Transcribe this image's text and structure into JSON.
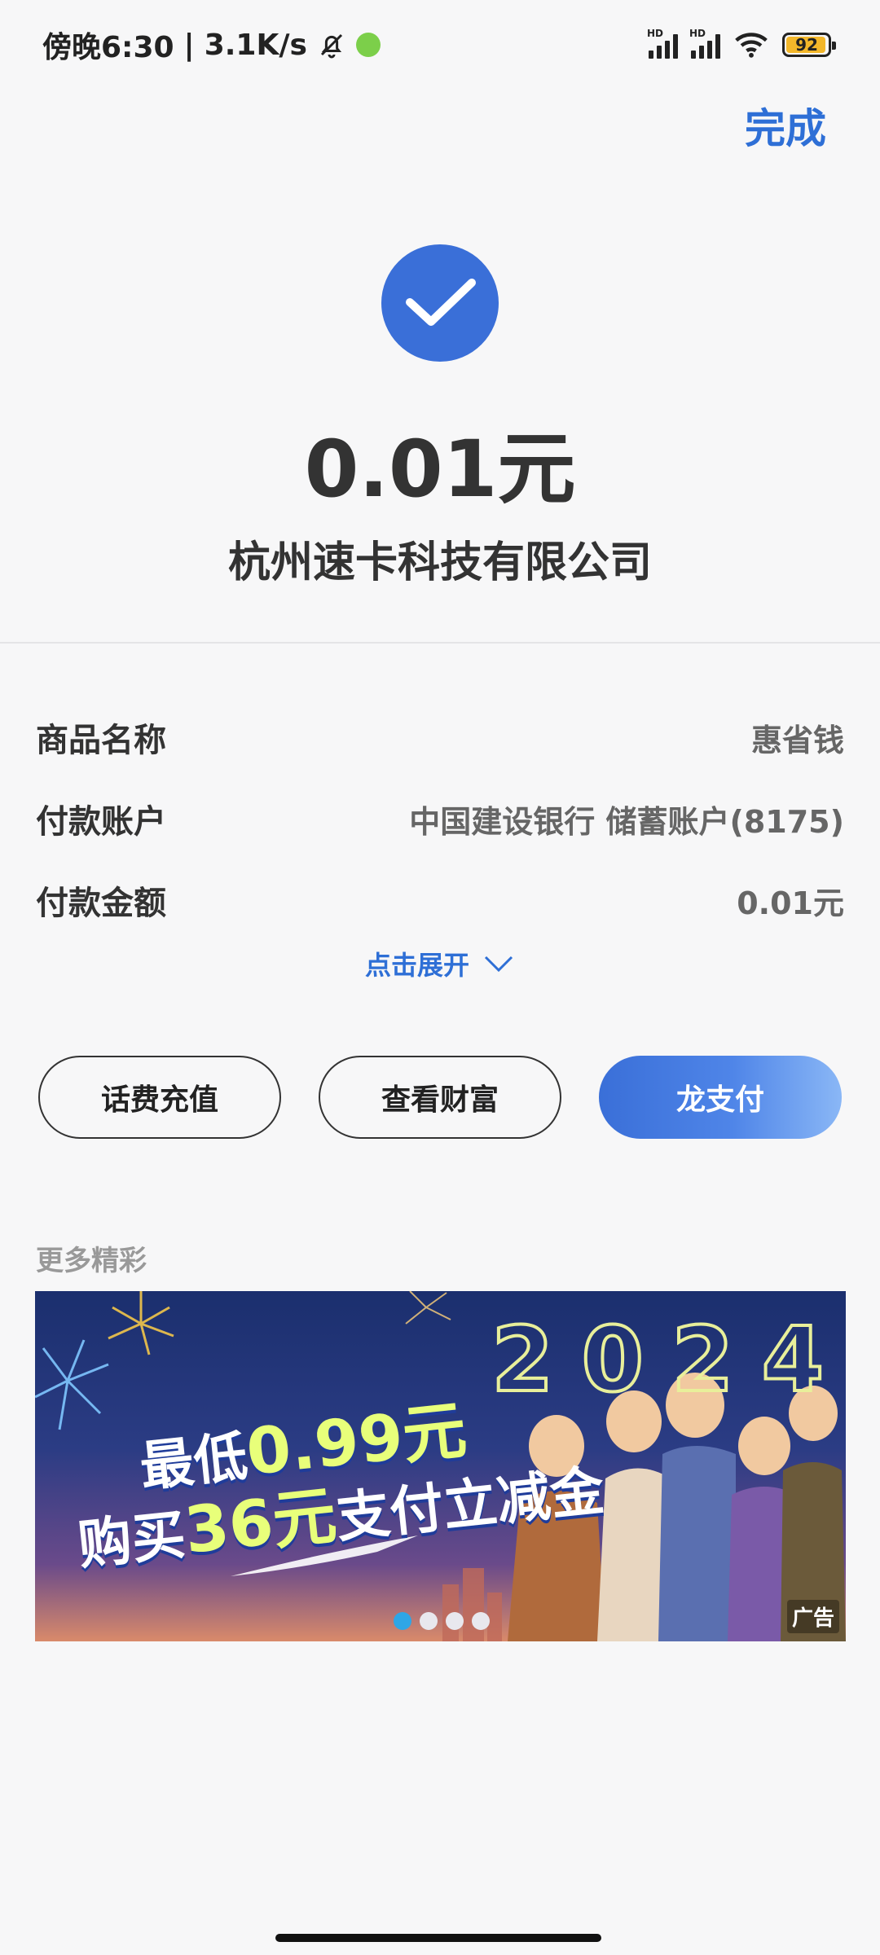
{
  "status_bar": {
    "time": "傍晚6:30",
    "speed": "3.1K/s",
    "separator": "|",
    "hd1": "HD",
    "hd2": "HD",
    "battery": "92"
  },
  "header": {
    "done_label": "完成"
  },
  "result": {
    "amount": "0.01元",
    "merchant": "杭州速卡科技有限公司"
  },
  "details": [
    {
      "label": "商品名称",
      "value": "惠省钱"
    },
    {
      "label": "付款账户",
      "value": "中国建设银行 储蓄账户(8175)"
    },
    {
      "label": "付款金额",
      "value": "0.01元"
    }
  ],
  "expand_label": "点击展开",
  "actions": [
    {
      "label": "话费充值"
    },
    {
      "label": "查看财富"
    },
    {
      "label": "龙支付"
    }
  ],
  "more_title": "更多精彩",
  "banner": {
    "year": "2024",
    "line1_prefix": "最低",
    "line1_highlight": "0.99元",
    "line2_prefix": "购买",
    "line2_highlight": "36元",
    "line2_suffix": "支付立减金",
    "ad_label": "广告",
    "dot_count": 4,
    "active_dot": 1
  },
  "colors": {
    "accent": "#3a6fd8",
    "link": "#2e6fd6",
    "background": "#f7f7f8"
  }
}
